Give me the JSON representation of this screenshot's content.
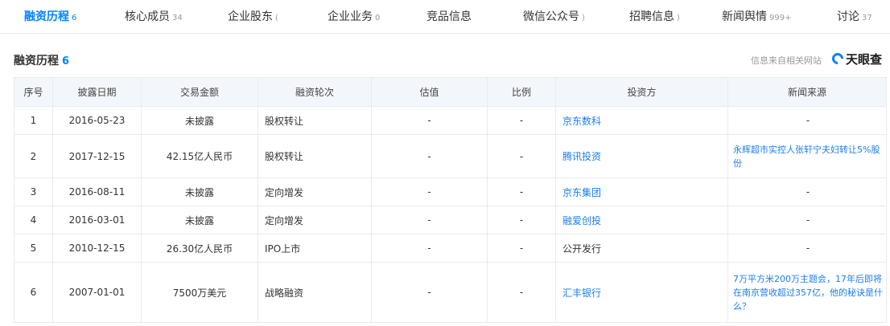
{
  "tabs": [
    {
      "label": "融资历程",
      "count": "6"
    },
    {
      "label": "核心成员",
      "count": "34"
    },
    {
      "label": "企业股东",
      "count": "("
    },
    {
      "label": "企业业务",
      "count": "0"
    },
    {
      "label": "竞品信息",
      "count": ""
    },
    {
      "label": "微信公众号",
      "count": ")"
    },
    {
      "label": "招聘信息",
      "count": ")"
    },
    {
      "label": "新闻舆情",
      "count": "999+"
    },
    {
      "label": "讨论",
      "count": "37"
    }
  ],
  "section": {
    "title": "融资历程",
    "count": "6",
    "source": "信息来自相关网站",
    "brand": "天眼查",
    "brand_color": "#0084ff"
  },
  "table": {
    "headers": [
      "序号",
      "披露日期",
      "交易金额",
      "融资轮次",
      "估值",
      "比例",
      "投资方",
      "新闻来源"
    ],
    "rows": [
      {
        "no": "1",
        "date": "2016-05-23",
        "amount": "未披露",
        "round": "股权转让",
        "valuation": "-",
        "ratio": "-",
        "investor": "京东数科",
        "news": "-"
      },
      {
        "no": "2",
        "date": "2017-12-15",
        "amount": "42.15亿人民币",
        "round": "股权转让",
        "valuation": "-",
        "ratio": "-",
        "investor": "腾讯投资",
        "news": "永辉超市实控人张轩宁夫妇转让5%股份"
      },
      {
        "no": "3",
        "date": "2016-08-11",
        "amount": "未披露",
        "round": "定向增发",
        "valuation": "-",
        "ratio": "-",
        "investor": "京东集团",
        "news": "-"
      },
      {
        "no": "4",
        "date": "2016-03-01",
        "amount": "未披露",
        "round": "定向增发",
        "valuation": "-",
        "ratio": "-",
        "investor": "融爱创投",
        "news": "-"
      },
      {
        "no": "5",
        "date": "2010-12-15",
        "amount": "26.30亿人民币",
        "round": "IPO上市",
        "valuation": "-",
        "ratio": "-",
        "investor": "公开发行",
        "news": "-"
      },
      {
        "no": "6",
        "date": "2007-01-01",
        "amount": "7500万美元",
        "round": "战略融资",
        "valuation": "-",
        "ratio": "-",
        "investor": "汇丰银行",
        "news": "7万平方米200万主题会，17年后即将在南京营收超过357亿，他的秘诀是什么？"
      }
    ]
  }
}
